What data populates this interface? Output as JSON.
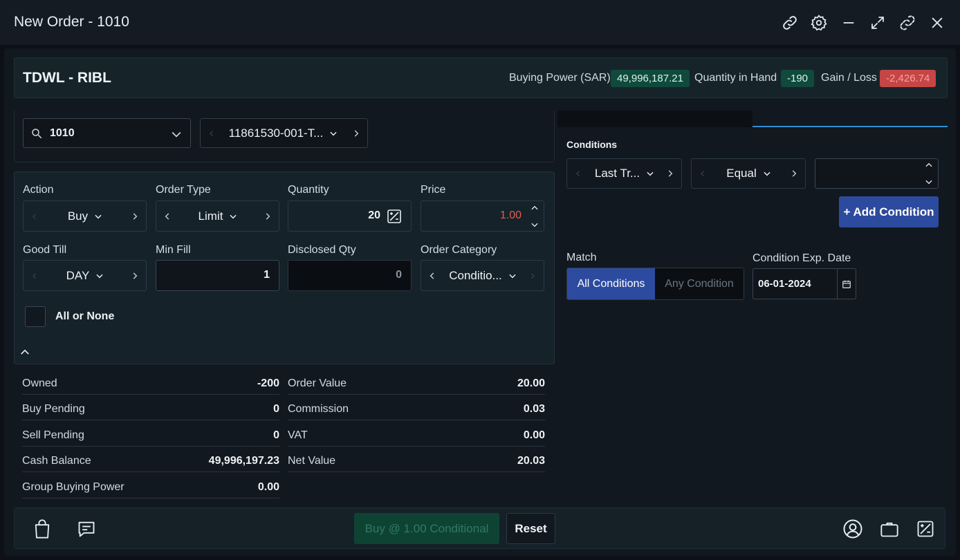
{
  "window": {
    "title": "New Order - 1010"
  },
  "header": {
    "symbol": "TDWL - RIBL",
    "buying_power_label": "Buying Power (SAR)",
    "buying_power_value": "49,996,187.21",
    "qty_in_hand_label": "Quantity in Hand",
    "qty_in_hand_value": "-190",
    "gain_loss_label": "Gain / Loss",
    "gain_loss_value": "-2,426.74"
  },
  "account": {
    "search_value": "1010",
    "portfolio_value": "11861530-001-T..."
  },
  "form": {
    "action_label": "Action",
    "action_value": "Buy",
    "order_type_label": "Order Type",
    "order_type_value": "Limit",
    "quantity_label": "Quantity",
    "quantity_value": "20",
    "price_label": "Price",
    "price_value": "1.00",
    "good_till_label": "Good Till",
    "good_till_value": "DAY",
    "min_fill_label": "Min Fill",
    "min_fill_value": "1",
    "disclosed_label": "Disclosed Qty",
    "disclosed_value": "0",
    "category_label": "Order Category",
    "category_value": "Conditio...",
    "all_or_none_label": "All or None"
  },
  "summary": {
    "left": [
      {
        "label": "Owned",
        "value": "-200"
      },
      {
        "label": "Buy Pending",
        "value": "0"
      },
      {
        "label": "Sell Pending",
        "value": "0"
      },
      {
        "label": "Cash Balance",
        "value": "49,996,197.23"
      },
      {
        "label": "Group Buying Power",
        "value": "0.00"
      }
    ],
    "right": [
      {
        "label": "Order Value",
        "value": "20.00"
      },
      {
        "label": "Commission",
        "value": "0.03"
      },
      {
        "label": "VAT",
        "value": "0.00"
      },
      {
        "label": "Net Value",
        "value": "20.03"
      }
    ]
  },
  "conditions": {
    "heading": "Conditions",
    "field_value": "Last Tr...",
    "operator_value": "Equal",
    "add_button": "+ Add Condition",
    "match_label": "Match",
    "match_all": "All Conditions",
    "match_any": "Any Condition",
    "exp_label": "Condition Exp. Date",
    "exp_value": "06-01-2024"
  },
  "footer": {
    "submit_label": "Buy @ 1.00 Conditional",
    "reset_label": "Reset"
  },
  "colors": {
    "accent_blue": "#2d4b9e",
    "gain_green": "#0f4a3c",
    "loss_red": "#c54646",
    "price_red": "#e45b50"
  }
}
